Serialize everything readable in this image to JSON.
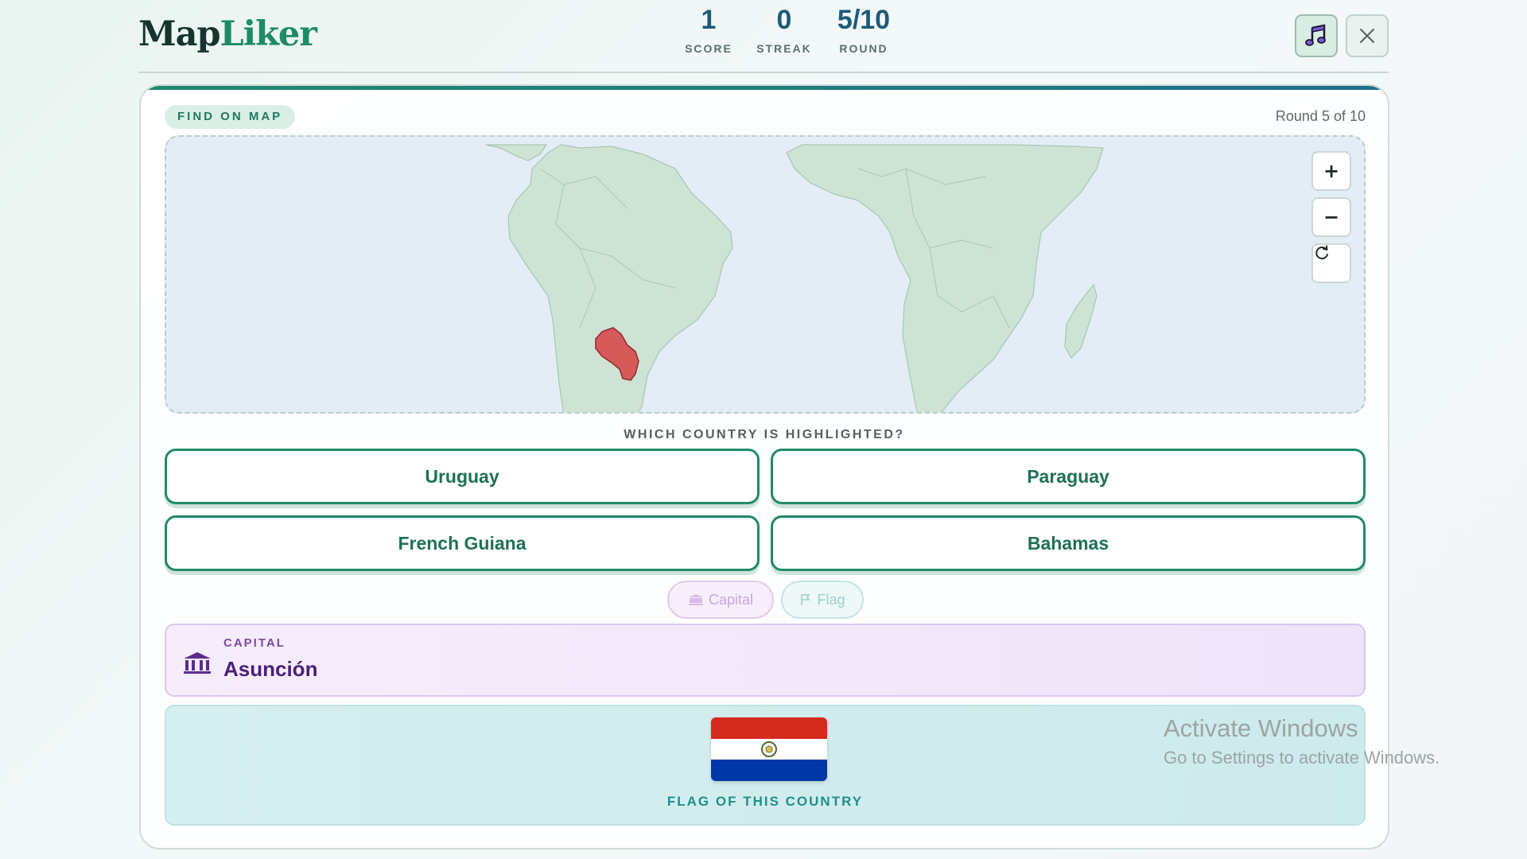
{
  "app": {
    "logo_part1": "Map",
    "logo_part2": "Liker"
  },
  "stats": [
    {
      "value": "1",
      "label": "SCORE"
    },
    {
      "value": "0",
      "label": "STREAK"
    },
    {
      "value": "5/10",
      "label": "ROUND"
    }
  ],
  "header_buttons": {
    "music_icon": "music-note-icon",
    "close_icon": "close-icon"
  },
  "card": {
    "badge": "FIND ON MAP",
    "round_label": "Round 5 of 10",
    "question": "WHICH COUNTRY IS HIGHLIGHTED?",
    "zoom_controls": {
      "zoom_in": "+",
      "zoom_out": "−",
      "reset_icon": "refresh-icon"
    },
    "map": {
      "highlighted_country": "Paraguay",
      "highlight_color": "#d65a5a",
      "land_color": "#cfe3d5",
      "ocean_color": "#e2edf6"
    },
    "options": [
      {
        "label": "Uruguay"
      },
      {
        "label": "Paraguay"
      },
      {
        "label": "French Guiana"
      },
      {
        "label": "Bahamas"
      }
    ],
    "hints": {
      "capital_label": "Capital",
      "flag_label": "Flag"
    },
    "capital_box": {
      "label": "CAPITAL",
      "value": "Asunción",
      "icon": "building-icon"
    },
    "flag_box": {
      "caption": "FLAG OF THIS COUNTRY",
      "colors": [
        "#d52b1e",
        "#ffffff",
        "#0038a8"
      ]
    }
  },
  "watermark": {
    "line1": "Activate Windows",
    "line2": "Go to Settings to activate Windows."
  }
}
